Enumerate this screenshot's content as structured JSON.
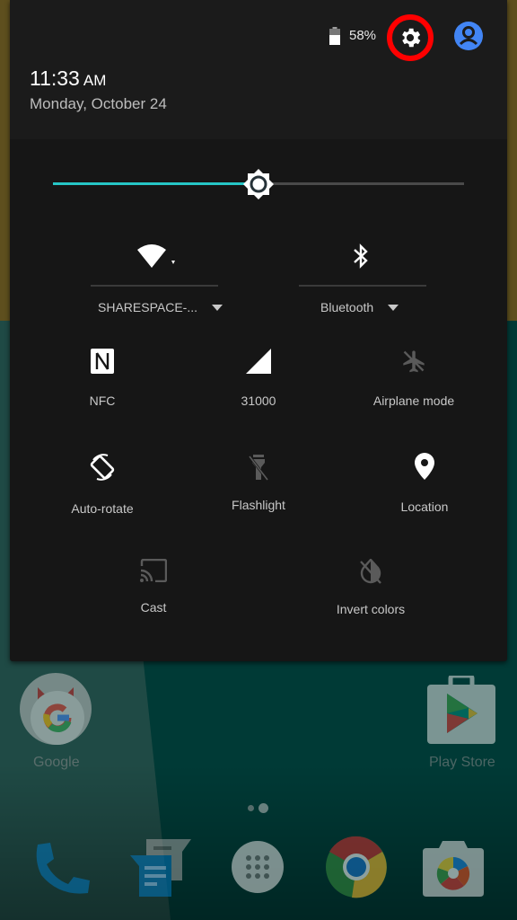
{
  "status": {
    "battery_percent": "58%",
    "battery_level": 0.58
  },
  "header": {
    "time": "11:33",
    "ampm": "AM",
    "date": "Monday, October 24"
  },
  "brightness": {
    "level": 0.5
  },
  "big_tiles": [
    {
      "id": "wifi",
      "label": "SHARESPACE-...",
      "icon": "wifi-icon"
    },
    {
      "id": "bluetooth",
      "label": "Bluetooth",
      "icon": "bluetooth-icon"
    }
  ],
  "tiles": [
    {
      "id": "nfc",
      "label": "NFC",
      "icon": "nfc-icon",
      "active": true
    },
    {
      "id": "cellular",
      "label": "31000",
      "icon": "signal-icon",
      "active": true
    },
    {
      "id": "airplane",
      "label": "Airplane mode",
      "icon": "airplane-icon",
      "active": false
    },
    {
      "id": "rotate",
      "label": "Auto-rotate",
      "icon": "rotate-icon",
      "active": true
    },
    {
      "id": "flashlight",
      "label": "Flashlight",
      "icon": "flashlight-icon",
      "active": false
    },
    {
      "id": "location",
      "label": "Location",
      "icon": "location-icon",
      "active": true
    },
    {
      "id": "cast",
      "label": "Cast",
      "icon": "cast-icon",
      "active": false
    },
    {
      "id": "invert",
      "label": "Invert colors",
      "icon": "invert-colors-icon",
      "active": false
    }
  ],
  "home": {
    "apps": [
      {
        "label": "Google"
      },
      {
        "label": "Play Store"
      }
    ],
    "dock": [
      "Phone",
      "Messages",
      "App drawer",
      "Chrome",
      "Camera"
    ]
  },
  "colors": {
    "accent": "#26c6c6",
    "highlight_ring": "#ff0000",
    "user_icon": "#4285f4",
    "panel": "#161616"
  }
}
